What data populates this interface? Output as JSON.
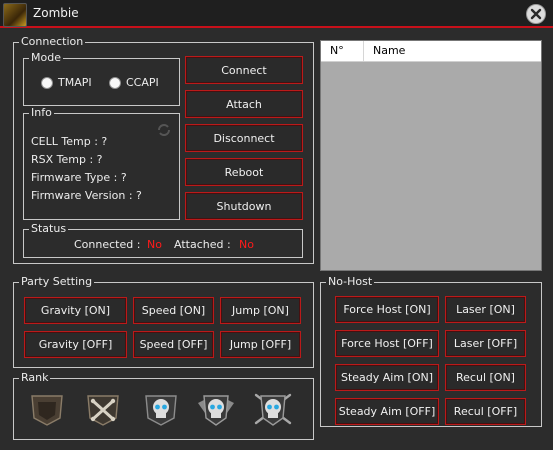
{
  "window": {
    "title": "Zombie"
  },
  "connection": {
    "legend": "Connection",
    "mode": {
      "legend": "Mode",
      "options": [
        "TMAPI",
        "CCAPI"
      ]
    },
    "info": {
      "legend": "Info",
      "lines": [
        "CELL Temp : ?",
        "RSX Temp : ?",
        "Firmware Type : ?",
        "Firmware Version : ?"
      ]
    },
    "buttons": {
      "connect": "Connect",
      "attach": "Attach",
      "disconnect": "Disconnect",
      "reboot": "Reboot",
      "shutdown": "Shutdown"
    },
    "status": {
      "legend": "Status",
      "connected_label": "Connected :",
      "connected_value": "No",
      "attached_label": "Attached :",
      "attached_value": "No"
    }
  },
  "list": {
    "columns": [
      "N°",
      "Name"
    ]
  },
  "party": {
    "legend": "Party Setting",
    "buttons": [
      "Gravity [ON]",
      "Speed [ON]",
      "Jump [ON]",
      "Gravity [OFF]",
      "Speed [OFF]",
      "Jump [OFF]"
    ]
  },
  "nohost": {
    "legend": "No-Host",
    "buttons": [
      "Force Host [ON]",
      "Laser [ON]",
      "Force Host [OFF]",
      "Laser [OFF]",
      "Steady Aim [ON]",
      "Recul [ON]",
      "Steady Aim [OFF]",
      "Recul [OFF]"
    ]
  },
  "rank": {
    "legend": "Rank",
    "icons": [
      "rank-shield-icon",
      "rank-crossed-bones-icon",
      "rank-skull-icon",
      "rank-winged-skull-icon",
      "rank-spiked-skull-icon"
    ]
  },
  "colors": {
    "accent": "#c8101a",
    "status_red": "#ff1a1a",
    "background": "#2c2c2c"
  }
}
